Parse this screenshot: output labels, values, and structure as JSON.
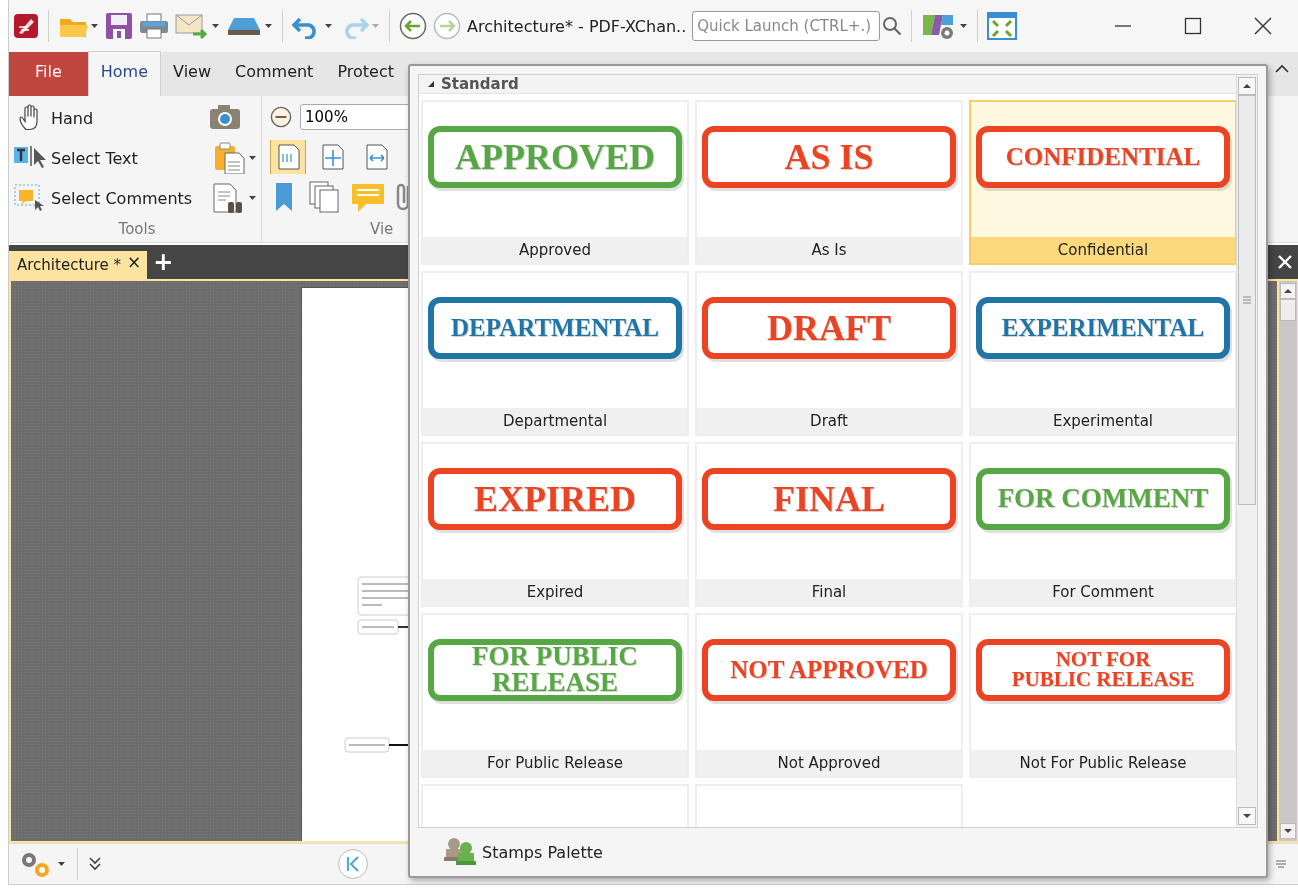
{
  "title_bar": {
    "title": "Architecture* - PDF-XChan..",
    "quick_launch": {
      "placeholder": "Quick Launch (CTRL+.)"
    }
  },
  "ribbon": {
    "tabs": [
      {
        "label": "File",
        "kind": "file",
        "selected": false
      },
      {
        "label": "Home",
        "kind": "tab",
        "selected": true
      },
      {
        "label": "View",
        "kind": "tab",
        "selected": false
      },
      {
        "label": "Comment",
        "kind": "tab",
        "selected": false
      },
      {
        "label": "Protect",
        "kind": "tab",
        "selected": false
      }
    ],
    "tools": [
      {
        "label": "Hand",
        "kind": "hand"
      },
      {
        "label": "Select Text",
        "kind": "text"
      },
      {
        "label": "Select Comments",
        "kind": "comments"
      }
    ],
    "tools_group": "Tools",
    "zoom": {
      "value": "100%"
    },
    "view_modes": [
      {
        "selected": true
      },
      {
        "selected": false
      },
      {
        "selected": false
      }
    ],
    "view_group": "Vie"
  },
  "document_tab": {
    "label": "Architecture *",
    "close": "×",
    "add": "+",
    "selected": true
  },
  "stamps_popup": {
    "group": "Standard",
    "expanded": true,
    "stamps": [
      {
        "kind": "stamp",
        "name": "Approved",
        "lines": [
          "APPROVED"
        ],
        "color": "#57a844",
        "selected": false
      },
      {
        "kind": "stamp",
        "name": "As Is",
        "lines": [
          "AS IS"
        ],
        "color": "#ec4323",
        "selected": false
      },
      {
        "kind": "stamp",
        "name": "Confidential",
        "lines": [
          "CONFIDENTIAL"
        ],
        "color": "#ec4323",
        "selected": true
      },
      {
        "kind": "stamp",
        "name": "Departmental",
        "lines": [
          "DEPARTMENTAL"
        ],
        "color": "#1f76a6",
        "selected": false
      },
      {
        "kind": "stamp",
        "name": "Draft",
        "lines": [
          "DRAFT"
        ],
        "color": "#ec4323",
        "selected": false
      },
      {
        "kind": "stamp",
        "name": "Experimental",
        "lines": [
          "EXPERIMENTAL"
        ],
        "color": "#1f76a6",
        "selected": false
      },
      {
        "kind": "stamp",
        "name": "Expired",
        "lines": [
          "EXPIRED"
        ],
        "color": "#ec4323",
        "selected": false
      },
      {
        "kind": "stamp",
        "name": "Final",
        "lines": [
          "FINAL"
        ],
        "color": "#ec4323",
        "selected": false
      },
      {
        "kind": "stamp",
        "name": "For Comment",
        "lines": [
          "FOR COMMENT"
        ],
        "color": "#57a844",
        "selected": false
      },
      {
        "kind": "stamp",
        "name": "For Public Release",
        "lines": [
          "FOR PUBLIC",
          "RELEASE"
        ],
        "color": "#57a844",
        "selected": false
      },
      {
        "kind": "stamp",
        "name": "Not Approved",
        "lines": [
          "NOT APPROVED"
        ],
        "color": "#ec4323",
        "selected": false
      },
      {
        "kind": "stamp",
        "name": "Not For Public Release",
        "lines": [
          "NOT FOR",
          "PUBLIC RELEASE"
        ],
        "color": "#ec4323",
        "selected": false
      },
      {
        "kind": "blank",
        "selected": false
      },
      {
        "kind": "blank",
        "selected": false
      }
    ],
    "footer": "Stamps Palette"
  }
}
